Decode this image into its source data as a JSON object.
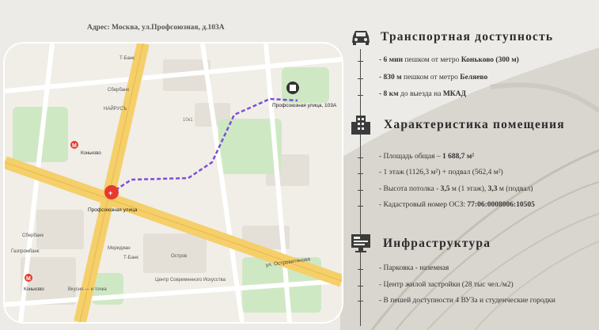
{
  "address": "Адрес: Москва, ул.Профсоюзная, д.103А",
  "map": {
    "pin_label": "Профсоюзная улица, 103А",
    "start_label": "Профсоюзная улица",
    "metro_konkovo": "Коньково",
    "metro_konkovo2": "Коньково",
    "street_ostrov": "ул. Островитянова",
    "poi_tbank": "Т-Банк",
    "poi_tbank2": "Т-Банк",
    "poi_sber": "Сбербанк",
    "poi_sber2": "Сбербанк",
    "poi_nayrus": "НАЙРУСЪ",
    "poi_mercury": "Меридиан",
    "poi_ostrov": "Остров",
    "poi_gazprom": "Газпромбанк",
    "poi_vkusno": "Вкусно — и точка",
    "poi_centre": "Центр Современного Искусства",
    "house_label": "10к1"
  },
  "transport": {
    "title": "Транспортная доступность",
    "items": [
      {
        "bold": "- 6 мин",
        "text": " пешком от метро ",
        "bold2": "Коньково (300 м)"
      },
      {
        "bold": "- 830 м",
        "text": " пешком от метро ",
        "bold2": "Беляево"
      },
      {
        "bold": "- 8 км",
        "text": " до выезда на ",
        "bold2": "МКАД"
      }
    ]
  },
  "premises": {
    "title": "Характеристика помещения",
    "area_prefix": "- Площадь общая – ",
    "area_value": "1 688,7 м²",
    "floors": "- 1 этаж (1126,3 м²) + подвал (562,4 м²)",
    "height_prefix": "- Высота потолка - ",
    "height_1": "3,5",
    "height_mid": " м (1 этаж), ",
    "height_2": "3,3",
    "height_suffix": " м (подвал)",
    "cadastre_prefix": "- Кадастровый номер ОСЗ: ",
    "cadastre_value": "77:06:0008006:10505"
  },
  "infra": {
    "title": "Инфраструктура",
    "items": [
      "- Парковка - наземная",
      "- Центр жилой застройки (28 тыс чел./м2)",
      "- В пешей доступности 4 ВУЗа и студенческие городки"
    ]
  },
  "colors": {
    "route": "#7b4fd6",
    "road_yellow": "#f5cf6a",
    "park": "#cfe8c4",
    "pin_red": "#e63a2e"
  }
}
